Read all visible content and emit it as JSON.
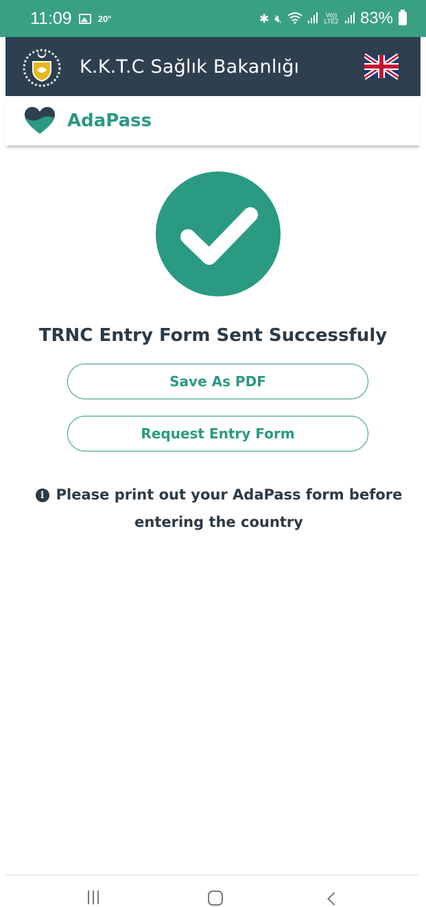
{
  "status_bar": {
    "time": "11:09",
    "temperature": "20°",
    "network_label": "Vo)) LTE2",
    "battery": "83%"
  },
  "header": {
    "title": "K.K.T.C Sağlık Bakanlığı",
    "language_flag": "uk-flag-icon"
  },
  "brand": {
    "name": "AdaPass"
  },
  "success": {
    "title": "TRNC Entry Form Sent Successfuly"
  },
  "actions": {
    "save_pdf": "Save As PDF",
    "request_entry": "Request Entry Form"
  },
  "notice": {
    "icon": "info-icon",
    "text": "Please print out your AdaPass form before entering the country"
  },
  "colors": {
    "status_bar": "#3aa082",
    "header": "#2e3f4f",
    "accent": "#2a9a82",
    "text_dark": "#2c3a45"
  }
}
